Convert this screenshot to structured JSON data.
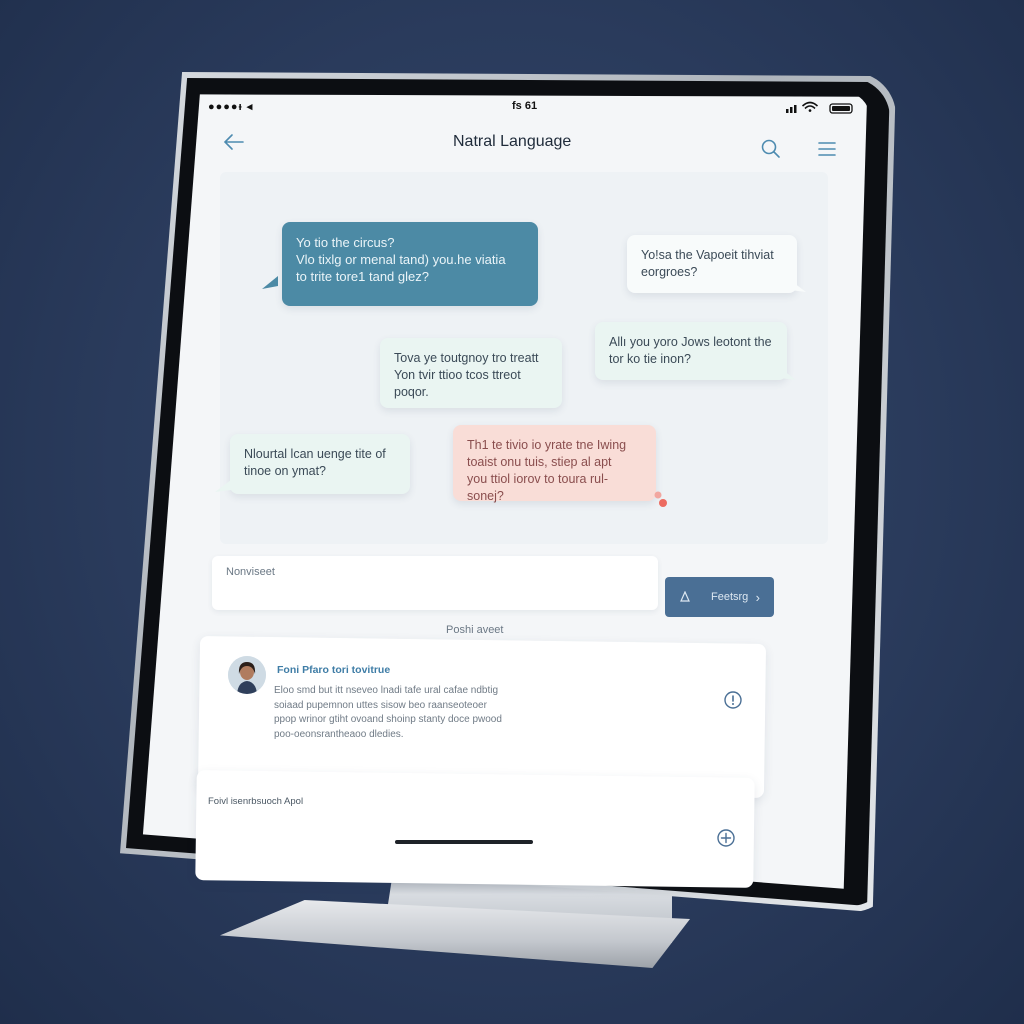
{
  "status_bar": {
    "left": "●●●●ᵻ ◂",
    "time": "fs 61"
  },
  "header": {
    "title": "Natral Language",
    "back_icon": "arrow-left-icon",
    "search_icon": "search-icon",
    "menu_icon": "hamburger-menu-icon"
  },
  "messages": [
    {
      "text_lines": [
        "Yo tio the circus?",
        "Vlo tixlg or menal tand) you.he viatia",
        "to trite tore1 tand glez?"
      ]
    },
    {
      "text_lines": [
        "Yo!sa the Vapoeit tihviat",
        "eorgroes?"
      ]
    },
    {
      "text_lines": [
        "Allı you yoro Jows leotont the",
        "tor ko tie inon?"
      ]
    },
    {
      "text_lines": [
        "Tova ye toutgnoy tro treatt",
        "Yon tvir ttioo tcos ttreot",
        "poqor."
      ]
    },
    {
      "text_lines": [
        "Nlourtal lcan uenge tite of",
        "tinoe on ymat?"
      ]
    },
    {
      "text_lines": [
        "Th1 te tivio io yrate tne Iwing",
        "toaist onu tuis, stiep al apt",
        "you ttiol iorov to toura rul-sonej?"
      ]
    }
  ],
  "input": {
    "placeholder": "Nonviseet"
  },
  "send_button": {
    "icon": "send-icon",
    "label": "Feetsrg",
    "chevron": "›"
  },
  "section_label": "Poshi aveet",
  "card": {
    "title": "Foni Pfaro tori tovitrue",
    "body_lines": [
      "Eloo smd but itt nseveo lnadi tafe ural cafae ndbtig",
      "soiaad pupemnon uttes sisow beo raanseoteoer",
      "ppop wrinor gtiht ovoand shoinp stanty doce pwood",
      "poo-oeonsrantheaoo dledies."
    ],
    "info_icon": "info-icon"
  },
  "card2": {
    "label": "Foivl isenrbsuoch Apol",
    "add_icon": "plus-circle-icon"
  },
  "colors": {
    "background": "#2a3b5c",
    "teal_bubble": "#4c8aa5",
    "pink_bubble": "#f9ddd7",
    "send_button": "#4a6f95",
    "accent_link": "#3f7da6"
  }
}
